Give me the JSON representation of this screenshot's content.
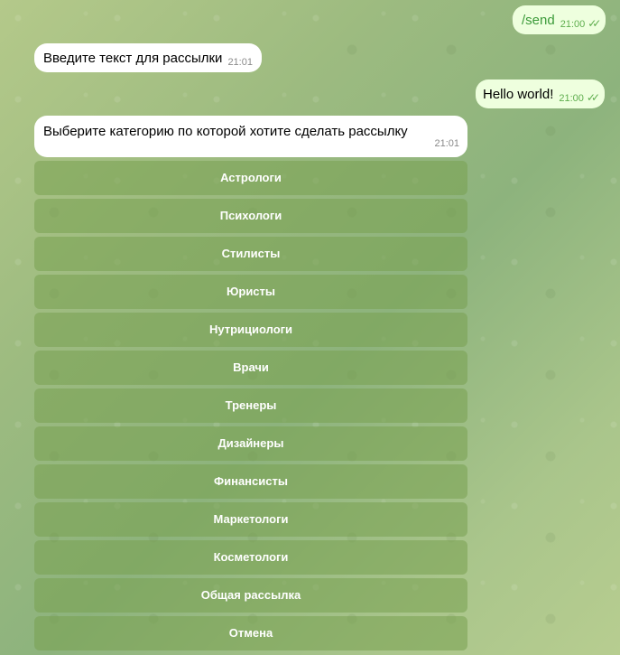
{
  "messages": [
    {
      "text": "/send",
      "time": "21:00",
      "direction": "outgoing",
      "status": "read"
    },
    {
      "text": "Введите текст для рассылки",
      "time": "21:01",
      "direction": "incoming"
    },
    {
      "text": "Hello world!",
      "time": "21:00",
      "direction": "outgoing",
      "status": "read"
    },
    {
      "text": "Выберите категорию по которой хотите сделать рассылку",
      "time": "21:01",
      "direction": "incoming"
    }
  ],
  "keyboard": [
    "Астрологи",
    "Психологи",
    "Стилисты",
    "Юристы",
    "Нутрициологи",
    "Врачи",
    "Тренеры",
    "Дизайнеры",
    "Финансисты",
    "Маркетологи",
    "Косметологи",
    "Общая рассылка",
    "Отмена"
  ],
  "colors": {
    "incoming_bubble": "#ffffff",
    "outgoing_bubble": "#eeffde",
    "outgoing_time": "#5fae4e",
    "keyboard_button": "#78a050"
  }
}
